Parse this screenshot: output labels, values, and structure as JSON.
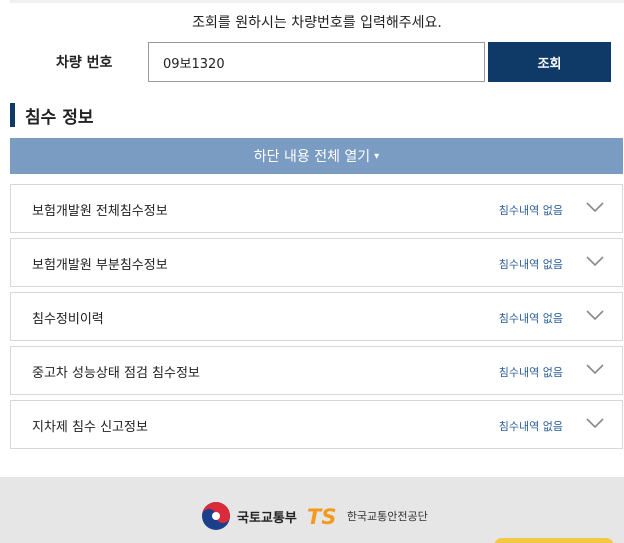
{
  "instruction": "조회를 원하시는 차량번호를 입력해주세요.",
  "vehicle": {
    "label": "차량 번호",
    "value": "09보1320",
    "search_label": "조회"
  },
  "section": {
    "title": "침수 정보"
  },
  "expand_all": {
    "label": "하단 내용 전체 열기",
    "caret": "▾"
  },
  "accordion": [
    {
      "title": "보험개발원 전체침수정보",
      "status": "침수내역 없음"
    },
    {
      "title": "보험개발원 부분침수정보",
      "status": "침수내역 없음"
    },
    {
      "title": "침수정비이력",
      "status": "침수내역 없음"
    },
    {
      "title": "중고차 성능상태 점검 침수정보",
      "status": "침수내역 없음"
    },
    {
      "title": "지차제 침수 신고정보",
      "status": "침수내역 없음"
    }
  ],
  "footer": {
    "ministry": "국토교통부",
    "agency": "한국교통안전공단",
    "ts_mark": "TS"
  },
  "colors": {
    "primary": "#0f3a67",
    "expand_bar": "#7b9cc2",
    "status_text": "#2a5e98",
    "ts_orange": "#f39a1e",
    "footer_bg": "#e6e6e6"
  }
}
